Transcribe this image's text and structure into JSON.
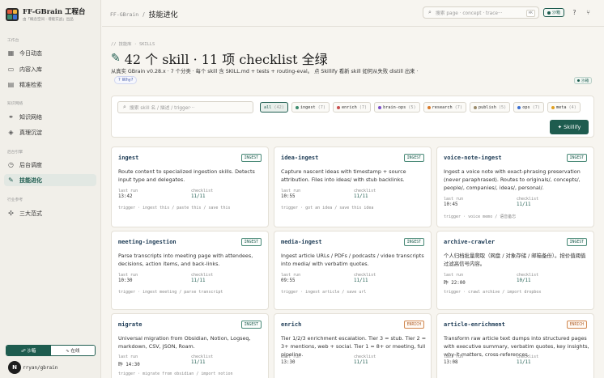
{
  "brand": {
    "title": "FF-GBrain 工程台",
    "subtitle": "由「概念空间 · 增能实战」出品",
    "logo_colors": [
      "#e05a3a",
      "#f0b33b",
      "#3c8b6e",
      "#3b6fd1"
    ]
  },
  "sidebar": {
    "sections": [
      {
        "label": "工作台",
        "items": [
          {
            "label": "今日动态",
            "icon": "dashboard-icon"
          },
          {
            "label": "内容入库",
            "icon": "inbox-icon"
          },
          {
            "label": "精准检索",
            "icon": "search-doc-icon"
          }
        ]
      },
      {
        "label": "知识网络",
        "items": [
          {
            "label": "知识网络",
            "icon": "network-icon"
          },
          {
            "label": "真理沉淀",
            "icon": "layers-icon"
          }
        ]
      },
      {
        "label": "后台引擎",
        "items": [
          {
            "label": "后台调度",
            "icon": "clock-icon"
          },
          {
            "label": "技能进化",
            "icon": "wrench-icon",
            "active": true
          }
        ]
      },
      {
        "label": "行业参考",
        "items": [
          {
            "label": "三大范式",
            "icon": "star-icon"
          }
        ]
      }
    ],
    "mode_sandbox": "☍ 沙箱",
    "mode_online": "∿ 在线",
    "avatar_letter": "N",
    "user": "rryan/gbrain"
  },
  "header": {
    "crumb_root": "FF-GBrain",
    "crumb_sep": "/",
    "crumb_current": "技能进化",
    "search_placeholder": "搜索 page · concept · trace···",
    "search_kbd": "⌘K",
    "sandbox_label": "沙箱",
    "accent": "#1e5c4f"
  },
  "main": {
    "kicker": "// 技能库 · SKILLS",
    "title": "42 个 skill · 11 项 checklist 全绿",
    "lede": "从真实 GBrain v0.28.x · 7 个分类 · 每个 skill 含 SKILL.md + tests + routing-eval。 点 Skillify 看新 skill 如何从失败 distill 出来 ·",
    "why": "Why?",
    "side_pill": "沙箱",
    "search_placeholder": "搜索 skill 名 / 描述 / trigger···",
    "skillify_label": "✦ Skillify",
    "chips": [
      {
        "label": "all",
        "count": "(42)",
        "color": "",
        "active": true
      },
      {
        "label": "ingest",
        "count": "(7)",
        "color": "#3c8b6e"
      },
      {
        "label": "enrich",
        "count": "(7)",
        "color": "#c94f4f"
      },
      {
        "label": "brain-ops",
        "count": "(5)",
        "color": "#7a4fc9"
      },
      {
        "label": "research",
        "count": "(7)",
        "color": "#d97a2b"
      },
      {
        "label": "publish",
        "count": "(5)",
        "color": "#9a8a6a"
      },
      {
        "label": "ops",
        "count": "(7)",
        "color": "#3b6fd1"
      },
      {
        "label": "meta",
        "count": "(4)",
        "color": "#e0a020"
      }
    ]
  },
  "cards": [
    {
      "name": "ingest",
      "tag": "INGEST",
      "type": "ingest",
      "desc": "Route content to specialized ingestion skills. Detects input type and delegates.",
      "last_run_label": "last run",
      "last_run": "13:42",
      "checklist_label": "checklist",
      "checklist": "11/11",
      "trigger": "trigger · ingest this / paste this / save this"
    },
    {
      "name": "idea-ingest",
      "tag": "INGEST",
      "type": "ingest",
      "desc": "Capture nascent ideas with timestamp + source attribution. Files into ideas/ with stub backlinks.",
      "last_run_label": "last run",
      "last_run": "10:55",
      "checklist_label": "checklist",
      "checklist": "11/11",
      "trigger": "trigger · got an idea / save this idea"
    },
    {
      "name": "voice-note-ingest",
      "tag": "INGEST",
      "type": "ingest",
      "desc": "Ingest a voice note with exact-phrasing preservation (never paraphrased). Routes to originals/, concepts/, people/, companies/, ideas/, personal/.",
      "last_run_label": "last run",
      "last_run": "10:45",
      "checklist_label": "checklist",
      "checklist": "11/11",
      "trigger": "trigger · voice memo / 语音备忘"
    },
    {
      "name": "meeting-ingestion",
      "tag": "INGEST",
      "type": "ingest",
      "desc": "Parse transcripts into meeting page with attendees, decisions, action items, and back-links.",
      "last_run_label": "last run",
      "last_run": "10:30",
      "checklist_label": "checklist",
      "checklist": "11/11",
      "trigger": "trigger · ingest meeting / parse transcript"
    },
    {
      "name": "media-ingest",
      "tag": "INGEST",
      "type": "ingest",
      "desc": "Ingest article URLs / PDFs / podcasts / video transcripts into media/ with verbatim quotes.",
      "last_run_label": "last run",
      "last_run": "09:55",
      "checklist_label": "checklist",
      "checklist": "11/11",
      "trigger": "trigger · ingest article / save url"
    },
    {
      "name": "archive-crawler",
      "tag": "INGEST",
      "type": "ingest",
      "desc": "个人归档批量爬取（网盘 / 对象存储 / 邮箱备份）。按价值阈值过滤高信号内容。",
      "last_run_label": "last run",
      "last_run": "昨 22:00",
      "checklist_label": "checklist",
      "checklist": "10/11",
      "trigger": "trigger · crawl archive / import dropbox"
    },
    {
      "name": "migrate",
      "tag": "INGEST",
      "type": "ingest",
      "desc": "Universal migration from Obsidian, Notion, Logseq, markdown, CSV, JSON, Roam.",
      "last_run_label": "last run",
      "last_run": "昨 14:30",
      "checklist_label": "checklist",
      "checklist": "11/11",
      "trigger": "trigger · migrate from obsidian / import notion"
    },
    {
      "name": "enrich",
      "tag": "ENRICH",
      "type": "enrich",
      "desc": "Tier 1/2/3 enrichment escalation. Tier 3 = stub. Tier 2 = 3+ mentions, web + social. Tier 1 = 8+ or meeting, full pipeline.",
      "last_run_label": "last run",
      "last_run": "13:30",
      "checklist_label": "checklist",
      "checklist": "11/11",
      "trigger": ""
    },
    {
      "name": "article-enrichment",
      "tag": "ENRICH",
      "type": "enrich",
      "desc": "Transform raw article text dumps into structured pages with executive summary, verbatim quotes, key insights, why-it-matters, cross-references.",
      "last_run_label": "last run",
      "last_run": "13:08",
      "checklist_label": "checklist",
      "checklist": "11/11",
      "trigger": ""
    }
  ]
}
